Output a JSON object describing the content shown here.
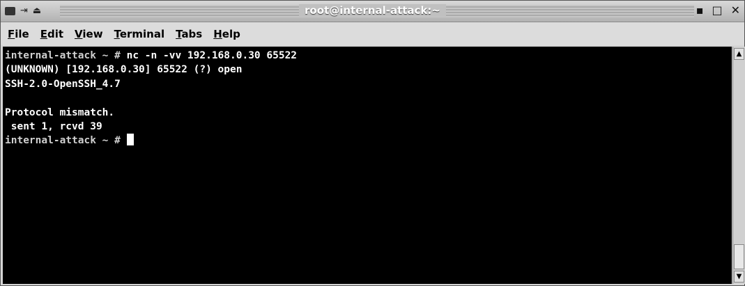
{
  "window": {
    "title": "root@internal-attack:~",
    "left_icons": [
      "window-menu-icon",
      "shade-icon",
      "eject-icon"
    ],
    "controls": [
      "minimize-icon",
      "maximize-icon",
      "close-icon"
    ]
  },
  "menu": [
    "File",
    "Edit",
    "View",
    "Terminal",
    "Tabs",
    "Help"
  ],
  "terminal": {
    "lines": [
      {
        "prompt": "internal-attack ~ # ",
        "text": "nc -n -vv 192.168.0.30 65522"
      },
      {
        "prompt": "",
        "text": "(UNKNOWN) [192.168.0.30] 65522 (?) open"
      },
      {
        "prompt": "",
        "text": "SSH-2.0-OpenSSH_4.7"
      },
      {
        "prompt": "",
        "text": ""
      },
      {
        "prompt": "",
        "text": "Protocol mismatch."
      },
      {
        "prompt": "",
        "text": " sent 1, rcvd 39"
      },
      {
        "prompt": "internal-attack ~ # ",
        "text": ""
      }
    ]
  },
  "colors": {
    "background": "#000000",
    "foreground": "#ffffff",
    "prompt": "#cfcfcf"
  }
}
